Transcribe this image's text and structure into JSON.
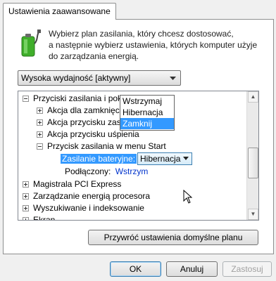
{
  "tab": {
    "label": "Ustawienia zaawansowane"
  },
  "description": {
    "line1": "Wybierz plan zasilania, który chcesz dostosować,",
    "line2": "a następnie wybierz ustawienia, których komputer użyje",
    "line3": "do zarządzania energią."
  },
  "plan_select": {
    "value": "Wysoka wydajność [aktywny]"
  },
  "tree": {
    "items": [
      {
        "label": "Przyciski zasilania i pokrywa"
      },
      {
        "label": "Akcja dla zamknięcia pokrywy"
      },
      {
        "label": "Akcja przycisku zasilania"
      },
      {
        "label": "Akcja przycisku uśpienia"
      },
      {
        "label": "Przycisk zasilania w menu Start"
      },
      {
        "label": "Zasilanie bateryjne:"
      },
      {
        "label": "Podłączony:"
      },
      {
        "label": "Magistrala PCI Express"
      },
      {
        "label": "Zarządzanie energią procesora"
      },
      {
        "label": "Wyszukiwanie i indeksowanie"
      },
      {
        "label": "Ekran"
      }
    ],
    "battery_combo_value": "Hibernacja",
    "plugged_value": "Wstrzym",
    "dropdown_options": [
      "Wstrzymaj",
      "Hibernacja",
      "Zamknij"
    ],
    "dropdown_selected": "Zamknij"
  },
  "buttons": {
    "restore": "Przywróć ustawienia domyślne planu",
    "ok": "OK",
    "cancel": "Anuluj",
    "apply": "Zastosuj"
  },
  "colors": {
    "selection": "#3399ff",
    "battery_green": "#3fae2a"
  }
}
